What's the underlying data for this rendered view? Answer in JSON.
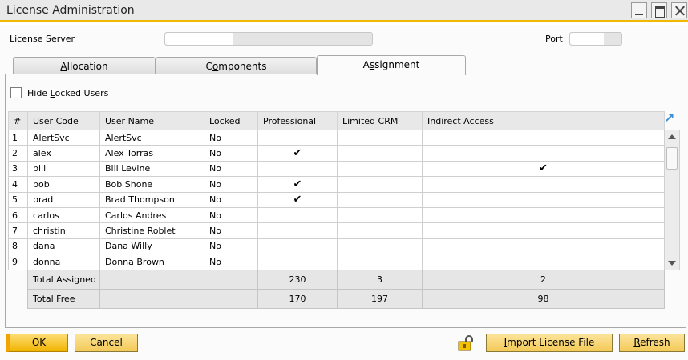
{
  "window": {
    "title": "License Administration"
  },
  "header": {
    "license_server_label": "License Server",
    "port_label": "Port"
  },
  "tabs": [
    {
      "label": "Allocation",
      "mnemonic": "A",
      "rest": "llocation"
    },
    {
      "label": "Components",
      "pre": "C",
      "mnemonic": "o",
      "rest": "mponents"
    },
    {
      "label": "Assignment",
      "pre": "A",
      "mnemonic": "s",
      "rest": "signment"
    }
  ],
  "hide_locked": {
    "pre": "Hide ",
    "mnemonic": "L",
    "rest": "ocked Users",
    "checked": false
  },
  "grid": {
    "columns": [
      "#",
      "User Code",
      "User Name",
      "Locked",
      "Professional",
      "Limited CRM",
      "Indirect Access"
    ],
    "rows": [
      {
        "num": "1",
        "code": "AlertSvc",
        "name": "AlertSvc",
        "locked": "No",
        "professional": "",
        "limited_crm": "",
        "indirect": ""
      },
      {
        "num": "2",
        "code": "alex",
        "name": "Alex Torras",
        "locked": "No",
        "professional": "✔",
        "limited_crm": "",
        "indirect": ""
      },
      {
        "num": "3",
        "code": "bill",
        "name": "Bill Levine",
        "locked": "No",
        "professional": "",
        "limited_crm": "",
        "indirect": "✔"
      },
      {
        "num": "4",
        "code": "bob",
        "name": "Bob Shone",
        "locked": "No",
        "professional": "✔",
        "limited_crm": "",
        "indirect": ""
      },
      {
        "num": "5",
        "code": "brad",
        "name": "Brad Thompson",
        "locked": "No",
        "professional": "✔",
        "limited_crm": "",
        "indirect": ""
      },
      {
        "num": "6",
        "code": "carlos",
        "name": "Carlos Andres",
        "locked": "No",
        "professional": "",
        "limited_crm": "",
        "indirect": ""
      },
      {
        "num": "7",
        "code": "christin",
        "name": "Christine Roblet",
        "locked": "No",
        "professional": "",
        "limited_crm": "",
        "indirect": ""
      },
      {
        "num": "8",
        "code": "dana",
        "name": "Dana Willy",
        "locked": "No",
        "professional": "",
        "limited_crm": "",
        "indirect": ""
      },
      {
        "num": "9",
        "code": "donna",
        "name": "Donna Brown",
        "locked": "No",
        "professional": "",
        "limited_crm": "",
        "indirect": ""
      }
    ]
  },
  "totals": {
    "assigned": {
      "label": "Total Assigned",
      "professional": "230",
      "limited_crm": "3",
      "indirect": "2"
    },
    "free": {
      "label": "Total Free",
      "professional": "170",
      "limited_crm": "197",
      "indirect": "98"
    }
  },
  "buttons": {
    "ok": "OK",
    "cancel": "Cancel",
    "import": {
      "mnemonic": "I",
      "rest": "mport License File"
    },
    "refresh": {
      "mnemonic": "R",
      "rest": "efresh"
    }
  },
  "icons": {
    "expand": "expand-arrow-icon",
    "lock": "lock-icon"
  },
  "colors": {
    "accent": "#f0b800",
    "button": "#f4c957"
  }
}
